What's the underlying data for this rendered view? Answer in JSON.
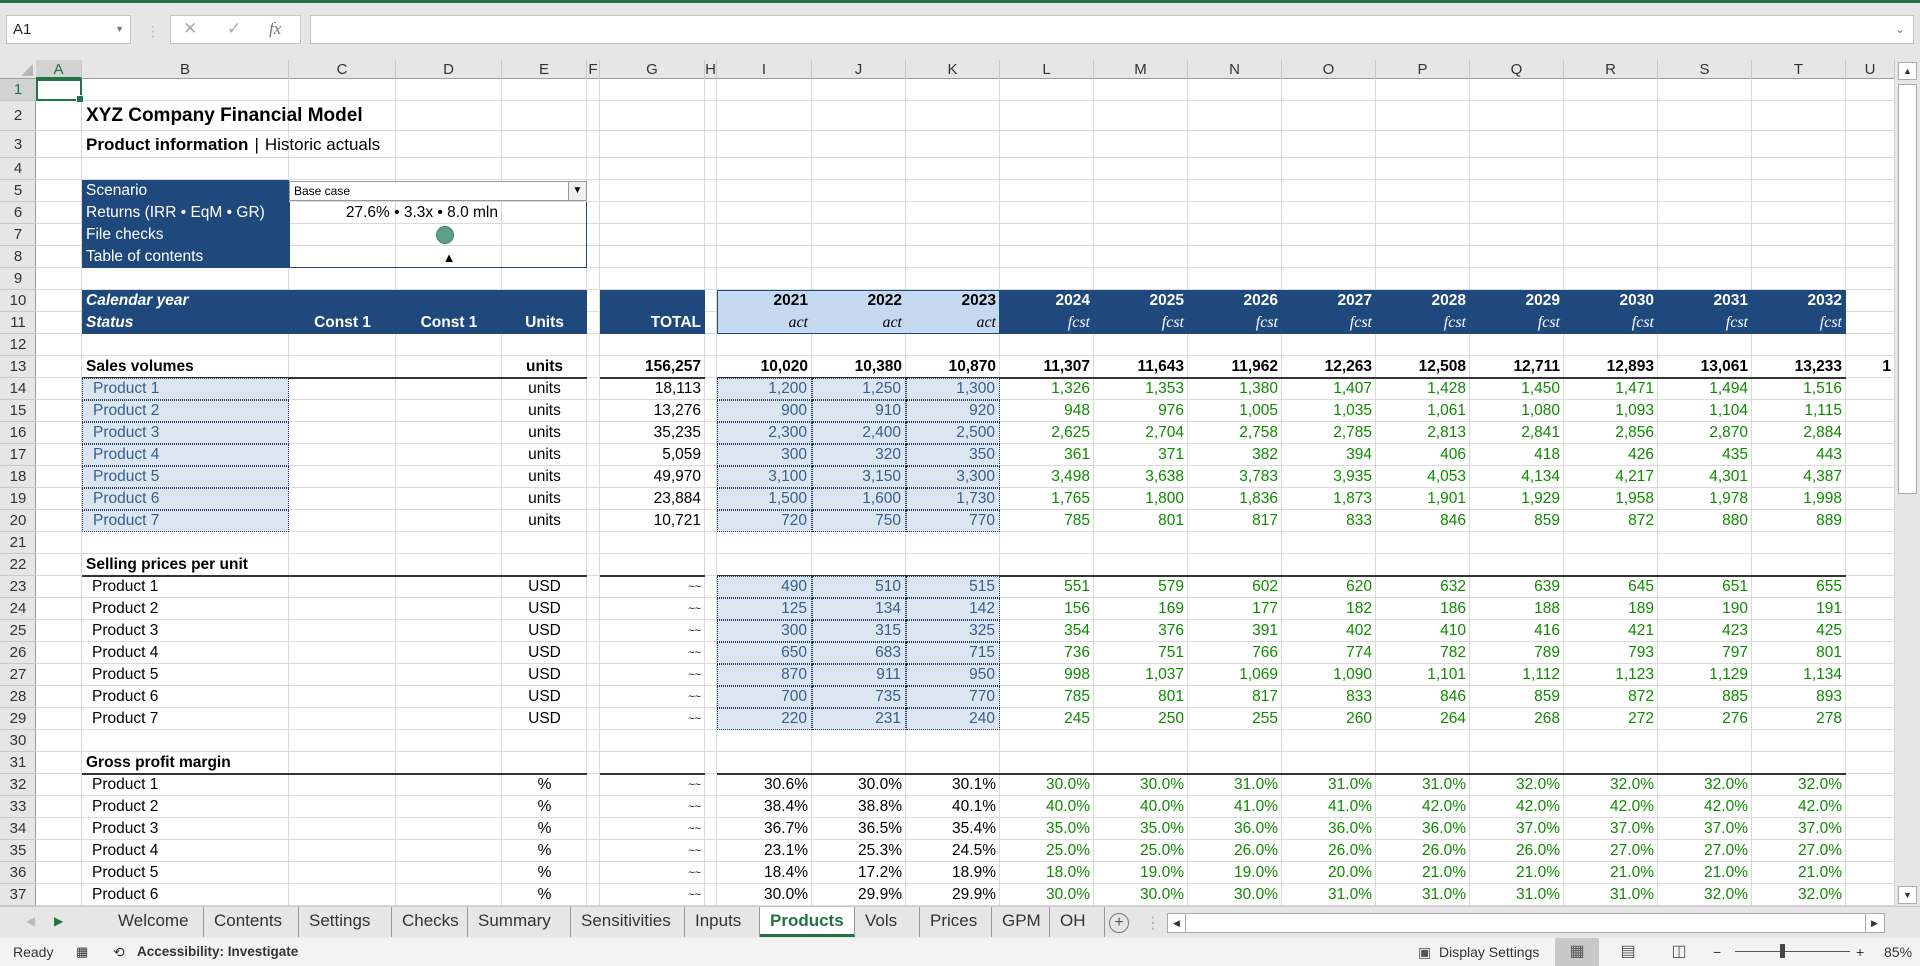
{
  "app": {
    "name_box": "A1",
    "formula_buttons": {
      "cancel": "✕",
      "enter": "✓",
      "fx": "fx"
    },
    "formula_value": ""
  },
  "columns": [
    "A",
    "B",
    "C",
    "D",
    "E",
    "F",
    "G",
    "H",
    "I",
    "J",
    "K",
    "L",
    "M",
    "N",
    "O",
    "P",
    "Q",
    "R",
    "S",
    "T",
    "U"
  ],
  "selected_cell": "A1",
  "sheet": {
    "title": "XYZ Company Financial Model",
    "subtitle_bold": "Product information",
    "subtitle_sep": "|",
    "subtitle_rest": "Historic actuals",
    "info_box": {
      "scenario_label": "Scenario",
      "scenario_value": "Base case",
      "returns_label": "Returns (IRR • EqM • GR)",
      "returns_value": "27.6% • 3.3x • 8.0 mln",
      "file_checks_label": "File checks",
      "file_checks_status_color": "#5f9e87",
      "toc_label": "Table of contents",
      "toc_glyph": "▲"
    },
    "header": {
      "calendar_year_label": "Calendar year",
      "status_label": "Status",
      "const1_c": "Const 1",
      "const1_d": "Const 1",
      "units": "Units",
      "total": "TOTAL",
      "years": [
        "2021",
        "2022",
        "2023",
        "2024",
        "2025",
        "2026",
        "2027",
        "2028",
        "2029",
        "2030",
        "2031",
        "2032"
      ],
      "status": [
        "act",
        "act",
        "act",
        "fcst",
        "fcst",
        "fcst",
        "fcst",
        "fcst",
        "fcst",
        "fcst",
        "fcst",
        "fcst"
      ]
    },
    "sales_volumes": {
      "label": "Sales volumes",
      "units": "units",
      "total": "156,257",
      "values": [
        "10,020",
        "10,380",
        "10,870",
        "11,307",
        "11,643",
        "11,962",
        "12,263",
        "12,508",
        "12,711",
        "12,893",
        "13,061",
        "13,233"
      ],
      "overflow_glyph": "1",
      "products": [
        {
          "name": "Product 1",
          "units": "units",
          "total": "18,113",
          "values": [
            "1,200",
            "1,250",
            "1,300",
            "1,326",
            "1,353",
            "1,380",
            "1,407",
            "1,428",
            "1,450",
            "1,471",
            "1,494",
            "1,516"
          ]
        },
        {
          "name": "Product 2",
          "units": "units",
          "total": "13,276",
          "values": [
            "900",
            "910",
            "920",
            "948",
            "976",
            "1,005",
            "1,035",
            "1,061",
            "1,080",
            "1,093",
            "1,104",
            "1,115"
          ]
        },
        {
          "name": "Product 3",
          "units": "units",
          "total": "35,235",
          "values": [
            "2,300",
            "2,400",
            "2,500",
            "2,625",
            "2,704",
            "2,758",
            "2,785",
            "2,813",
            "2,841",
            "2,856",
            "2,870",
            "2,884"
          ]
        },
        {
          "name": "Product 4",
          "units": "units",
          "total": "5,059",
          "values": [
            "300",
            "320",
            "350",
            "361",
            "371",
            "382",
            "394",
            "406",
            "418",
            "426",
            "435",
            "443"
          ]
        },
        {
          "name": "Product 5",
          "units": "units",
          "total": "49,970",
          "values": [
            "3,100",
            "3,150",
            "3,300",
            "3,498",
            "3,638",
            "3,783",
            "3,935",
            "4,053",
            "4,134",
            "4,217",
            "4,301",
            "4,387"
          ]
        },
        {
          "name": "Product 6",
          "units": "units",
          "total": "23,884",
          "values": [
            "1,500",
            "1,600",
            "1,730",
            "1,765",
            "1,800",
            "1,836",
            "1,873",
            "1,901",
            "1,929",
            "1,958",
            "1,978",
            "1,998"
          ]
        },
        {
          "name": "Product 7",
          "units": "units",
          "total": "10,721",
          "values": [
            "720",
            "750",
            "770",
            "785",
            "801",
            "817",
            "833",
            "846",
            "859",
            "872",
            "880",
            "889"
          ]
        }
      ]
    },
    "selling_prices": {
      "label": "Selling prices per unit",
      "products": [
        {
          "name": "Product 1",
          "units": "USD",
          "total": "~~",
          "values": [
            "490",
            "510",
            "515",
            "551",
            "579",
            "602",
            "620",
            "632",
            "639",
            "645",
            "651",
            "655"
          ]
        },
        {
          "name": "Product 2",
          "units": "USD",
          "total": "~~",
          "values": [
            "125",
            "134",
            "142",
            "156",
            "169",
            "177",
            "182",
            "186",
            "188",
            "189",
            "190",
            "191"
          ]
        },
        {
          "name": "Product 3",
          "units": "USD",
          "total": "~~",
          "values": [
            "300",
            "315",
            "325",
            "354",
            "376",
            "391",
            "402",
            "410",
            "416",
            "421",
            "423",
            "425"
          ]
        },
        {
          "name": "Product 4",
          "units": "USD",
          "total": "~~",
          "values": [
            "650",
            "683",
            "715",
            "736",
            "751",
            "766",
            "774",
            "782",
            "789",
            "793",
            "797",
            "801"
          ]
        },
        {
          "name": "Product 5",
          "units": "USD",
          "total": "~~",
          "values": [
            "870",
            "911",
            "950",
            "998",
            "1,037",
            "1,069",
            "1,090",
            "1,101",
            "1,112",
            "1,123",
            "1,129",
            "1,134"
          ]
        },
        {
          "name": "Product 6",
          "units": "USD",
          "total": "~~",
          "values": [
            "700",
            "735",
            "770",
            "785",
            "801",
            "817",
            "833",
            "846",
            "859",
            "872",
            "885",
            "893"
          ]
        },
        {
          "name": "Product 7",
          "units": "USD",
          "total": "~~",
          "values": [
            "220",
            "231",
            "240",
            "245",
            "250",
            "255",
            "260",
            "264",
            "268",
            "272",
            "276",
            "278"
          ]
        }
      ]
    },
    "gross_margin": {
      "label": "Gross profit margin",
      "products": [
        {
          "name": "Product 1",
          "units": "%",
          "total": "~~",
          "values": [
            "30.6%",
            "30.0%",
            "30.1%",
            "30.0%",
            "30.0%",
            "31.0%",
            "31.0%",
            "31.0%",
            "32.0%",
            "32.0%",
            "32.0%",
            "32.0%"
          ]
        },
        {
          "name": "Product 2",
          "units": "%",
          "total": "~~",
          "values": [
            "38.4%",
            "38.8%",
            "40.1%",
            "40.0%",
            "40.0%",
            "41.0%",
            "41.0%",
            "42.0%",
            "42.0%",
            "42.0%",
            "42.0%",
            "42.0%"
          ]
        },
        {
          "name": "Product 3",
          "units": "%",
          "total": "~~",
          "values": [
            "36.7%",
            "36.5%",
            "35.4%",
            "35.0%",
            "35.0%",
            "36.0%",
            "36.0%",
            "36.0%",
            "37.0%",
            "37.0%",
            "37.0%",
            "37.0%"
          ]
        },
        {
          "name": "Product 4",
          "units": "%",
          "total": "~~",
          "values": [
            "23.1%",
            "25.3%",
            "24.5%",
            "25.0%",
            "25.0%",
            "26.0%",
            "26.0%",
            "26.0%",
            "26.0%",
            "27.0%",
            "27.0%",
            "27.0%"
          ]
        },
        {
          "name": "Product 5",
          "units": "%",
          "total": "~~",
          "values": [
            "18.4%",
            "17.2%",
            "18.9%",
            "18.0%",
            "19.0%",
            "19.0%",
            "20.0%",
            "21.0%",
            "21.0%",
            "21.0%",
            "21.0%",
            "21.0%"
          ]
        },
        {
          "name": "Product 6",
          "units": "%",
          "total": "~~",
          "values": [
            "30.0%",
            "29.9%",
            "29.9%",
            "30.0%",
            "30.0%",
            "30.0%",
            "31.0%",
            "31.0%",
            "31.0%",
            "31.0%",
            "32.0%",
            "32.0%"
          ]
        }
      ]
    }
  },
  "tabs": [
    "Welcome",
    "Contents",
    "Settings",
    "Checks",
    "Summary",
    "Sensitivities",
    "Inputs",
    "Products",
    "Vols",
    "Prices",
    "GPM",
    "OH ..."
  ],
  "active_tab": "Products",
  "status": {
    "ready": "Ready",
    "accessibility": "Accessibility: Investigate",
    "display_settings": "Display Settings",
    "zoom": "85%",
    "zoom_level": 0.85
  },
  "colors": {
    "accent": "#217346",
    "header_navy": "#1f497d",
    "actuals_header": "#c5d9f1",
    "input_fill": "#dce6f1",
    "input_text": "#365f91",
    "forecast_text": "#0f8a00"
  }
}
